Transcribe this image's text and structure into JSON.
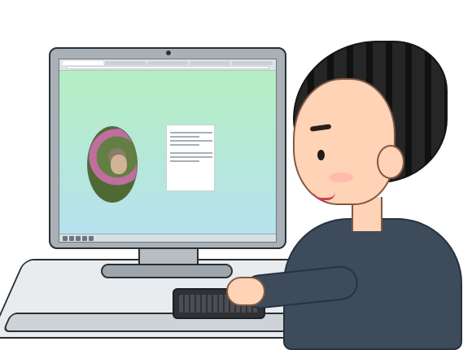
{
  "screen": {
    "site_title": "",
    "nav": [
      "",
      ""
    ],
    "heading": "",
    "bio_text": "",
    "footer_link": "",
    "clock": ""
  }
}
